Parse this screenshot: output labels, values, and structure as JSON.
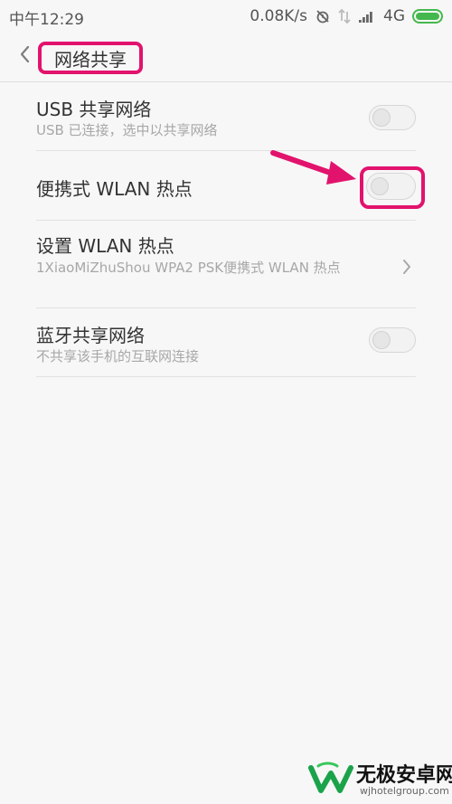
{
  "status_bar": {
    "time": "中午12:29",
    "speed": "0.08K/s",
    "network": "4G"
  },
  "header": {
    "title": "网络共享"
  },
  "settings": [
    {
      "title": "USB 共享网络",
      "subtitle": "USB 已连接，选中以共享网络",
      "enabled": false
    },
    {
      "title": "便携式 WLAN 热点",
      "subtitle": "",
      "enabled": false
    },
    {
      "title": "设置 WLAN 热点",
      "subtitle": "1XiaoMiZhuShou WPA2 PSK便携式 WLAN 热点"
    },
    {
      "title": "蓝牙共享网络",
      "subtitle": "不共享该手机的互联网连接",
      "enabled": false
    }
  ],
  "watermark": {
    "text": "无极安卓网",
    "url": "wjhotelgroup.com"
  },
  "colors": {
    "highlight": "#e2136d",
    "battery": "#45b84d",
    "background": "#f7f7f7"
  },
  "icons": {
    "back": "chevron-left-icon",
    "forward": "chevron-right-icon",
    "signal": "signal-icon",
    "battery": "battery-icon",
    "alarm_off": "alarm-off-icon",
    "transfer": "data-transfer-icon"
  }
}
